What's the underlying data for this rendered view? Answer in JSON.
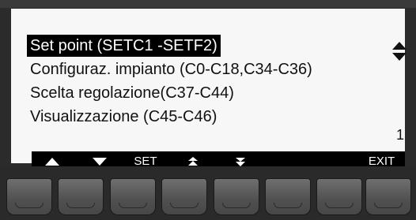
{
  "menu": {
    "items": [
      {
        "label": "Set point (SETC1 -SETF2)",
        "selected": true
      },
      {
        "label": "Configuraz. impianto (C0-C18,C34-C36)",
        "selected": false
      },
      {
        "label": "Scelta regolazione(C37-C44)",
        "selected": false
      },
      {
        "label": "Visualizzazione (C45-C46)",
        "selected": false
      }
    ]
  },
  "page_number": "1",
  "softkeys": {
    "up_icon": "up-triangle",
    "down_icon": "down-triangle",
    "set_label": "SET",
    "page_up_icon": "double-up-arrow",
    "page_down_icon": "double-down-arrow",
    "exit_label": "EXIT"
  },
  "scroll_indicator_icon": "up-down-arrows",
  "colors": {
    "screen_bg": "#f7f7f7",
    "highlight": "#000000",
    "bezel": "#2b2b2b"
  }
}
